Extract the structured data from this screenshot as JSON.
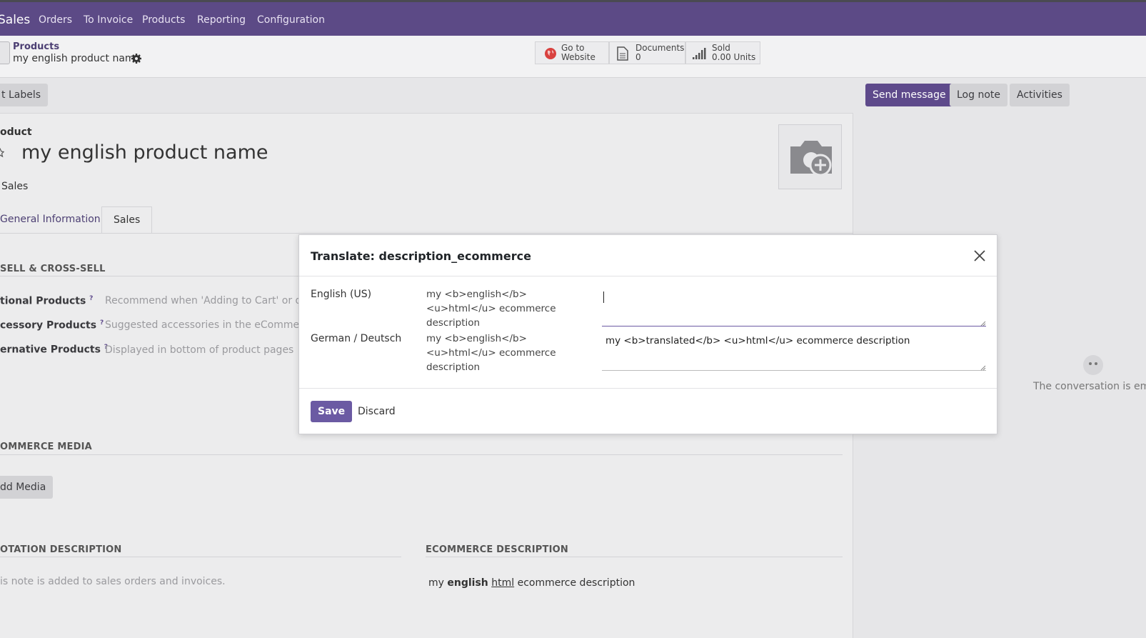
{
  "topbar": {
    "brand": "Sales",
    "nav": [
      "Orders",
      "To Invoice",
      "Products",
      "Reporting",
      "Configuration"
    ]
  },
  "breadcrumb": {
    "parent": "Products",
    "current": "my english product name"
  },
  "smart_buttons": [
    {
      "label_top": "Go to",
      "label_bottom": "Website",
      "icon": "globe-icon"
    },
    {
      "label_top": "Documents",
      "label_bottom": "0",
      "icon": "document-icon"
    },
    {
      "label_top": "Sold",
      "label_bottom": "0.00 Units",
      "icon": "bar-signal-icon"
    }
  ],
  "toolbar": {
    "print_labels": "t Labels"
  },
  "chatter": {
    "send_message": "Send message",
    "log_note": "Log note",
    "activities": "Activities",
    "empty_text": "The conversation is empt"
  },
  "form": {
    "type_label": "oduct",
    "product_name": "my english product name",
    "sales_checkbox_label": "Sales",
    "tabs": [
      "General Information",
      "Sales"
    ],
    "upsell_title": "SELL & CROSS-SELL",
    "fields": [
      {
        "label": "tional Products",
        "placeholder": "Recommend when 'Adding to Cart' or quot"
      },
      {
        "label": "cessory Products",
        "placeholder": "Suggested accessories in the eCommerce c"
      },
      {
        "label": "ernative Products",
        "placeholder": "Displayed in bottom of product pages"
      }
    ],
    "help_mark": "?",
    "media_title": "OMMERCE MEDIA",
    "add_media": "dd Media",
    "quotation_title": "OTATION DESCRIPTION",
    "quotation_placeholder": "is note is added to sales orders and invoices.",
    "ecommerce_title": "ECOMMERCE DESCRIPTION",
    "ecommerce_desc": {
      "w1": "my",
      "w2": "english",
      "w3": "html",
      "w4": "ecommerce description"
    }
  },
  "modal": {
    "title": "Translate: description_ecommerce",
    "rows": [
      {
        "lang": "English (US)",
        "source": "my <b>english</b> <u>html</u> ecommerce description",
        "value": ""
      },
      {
        "lang": "German / Deutsch",
        "source": "my <b>english</b> <u>html</u> ecommerce description",
        "value": "my <b>translated</b> <u>html</u> ecommerce description"
      }
    ],
    "save": "Save",
    "discard": "Discard"
  }
}
